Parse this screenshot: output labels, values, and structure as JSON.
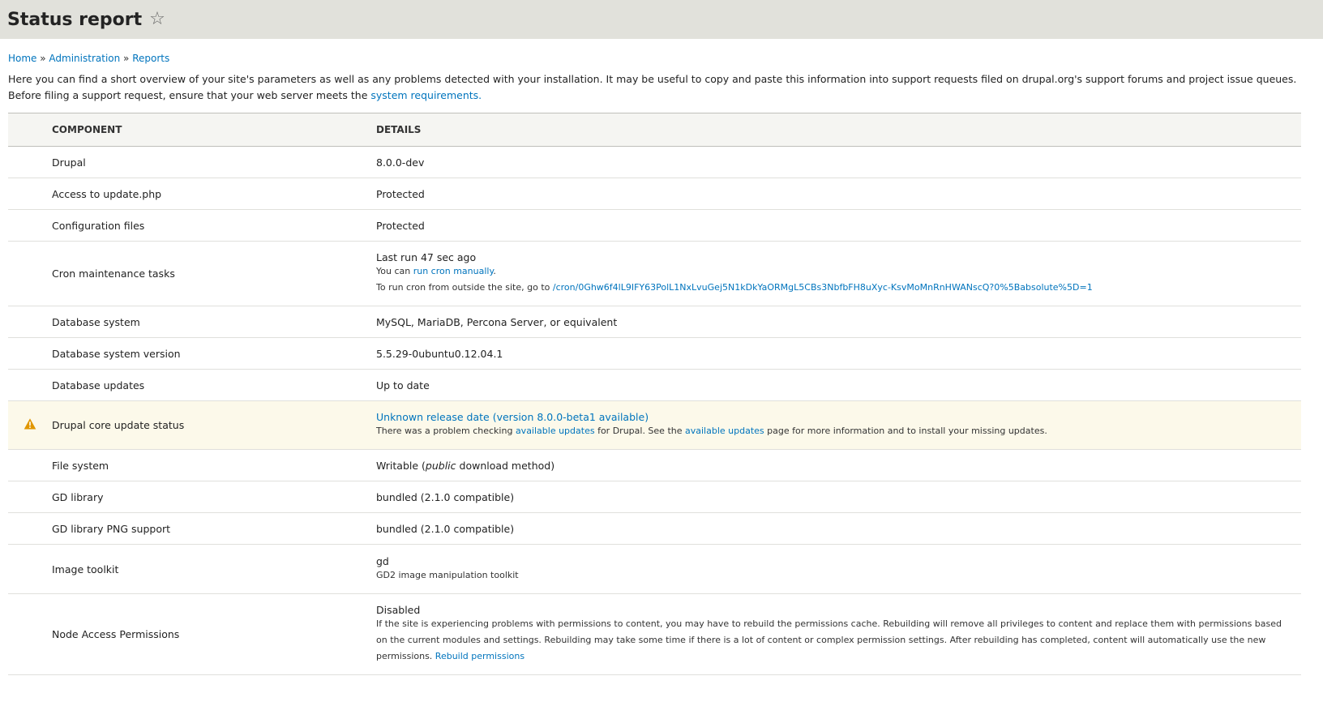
{
  "page": {
    "title": "Status report"
  },
  "breadcrumb": {
    "home": "Home",
    "sep1": " » ",
    "administration": "Administration",
    "sep2": " » ",
    "reports": "Reports"
  },
  "intro": {
    "text": "Here you can find a short overview of your site's parameters as well as any problems detected with your installation. It may be useful to copy and paste this information into support requests filed on drupal.org's support forums and project issue queues. Before filing a support request, ensure that your web server meets the ",
    "link": "system requirements."
  },
  "table": {
    "headers": {
      "component": "COMPONENT",
      "details": "DETAILS"
    },
    "rows": {
      "drupal": {
        "component": "Drupal",
        "value": "8.0.0-dev"
      },
      "update_php": {
        "component": "Access to update.php",
        "value": "Protected"
      },
      "config_files": {
        "component": "Configuration files",
        "value": "Protected"
      },
      "cron": {
        "component": "Cron maintenance tasks",
        "value": "Last run 47 sec ago",
        "line1_prefix": "You can ",
        "line1_link": "run cron manually",
        "line1_suffix": ".",
        "line2_prefix": "To run cron from outside the site, go to ",
        "line2_link": "/cron/0Ghw6f4lL9IFY63PolL1NxLvuGej5N1kDkYaORMgL5CBs3NbfbFH8uXyc-KsvMoMnRnHWANscQ?0%5Babsolute%5D=1"
      },
      "db_system": {
        "component": "Database system",
        "value": "MySQL, MariaDB, Percona Server, or equivalent"
      },
      "db_version": {
        "component": "Database system version",
        "value": "5.5.29-0ubuntu0.12.04.1"
      },
      "db_updates": {
        "component": "Database updates",
        "value": "Up to date"
      },
      "core_update": {
        "component": "Drupal core update status",
        "value_link": "Unknown release date (version 8.0.0-beta1 available)",
        "desc_p1": "There was a problem checking ",
        "desc_link1": "available updates",
        "desc_p2": " for Drupal. See the ",
        "desc_link2": "available updates",
        "desc_p3": " page for more information and to install your missing updates."
      },
      "file_system": {
        "component": "File system",
        "value_pre": "Writable (",
        "value_em": "public",
        "value_post": " download method)"
      },
      "gd_library": {
        "component": "GD library",
        "value": "bundled (2.1.0 compatible)"
      },
      "gd_png": {
        "component": "GD library PNG support",
        "value": "bundled (2.1.0 compatible)"
      },
      "image_toolkit": {
        "component": "Image toolkit",
        "value": "gd",
        "desc": "GD2 image manipulation toolkit"
      },
      "node_access": {
        "component": "Node Access Permissions",
        "value": "Disabled",
        "desc": "If the site is experiencing problems with permissions to content, you may have to rebuild the permissions cache. Rebuilding will remove all privileges to content and replace them with permissions based on the current modules and settings. Rebuilding may take some time if there is a lot of content or complex permission settings. After rebuilding has completed, content will automatically use the new permissions. ",
        "link": "Rebuild permissions"
      }
    }
  },
  "icons": {
    "favorite": "star-outline-icon",
    "warning": "warning-triangle-icon"
  },
  "colors": {
    "link": "#0074bd",
    "warning_row": "#fcf9ea",
    "warning_icon": "#e09600",
    "header_bg": "#e1e1db"
  }
}
